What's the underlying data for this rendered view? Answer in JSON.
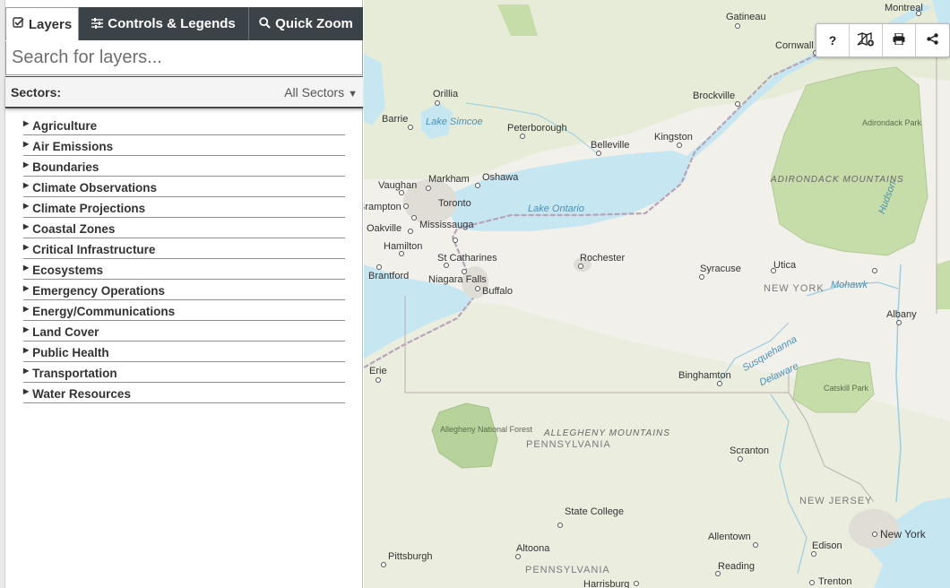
{
  "tabs": [
    {
      "label": "Layers",
      "icon": "checkbox-icon"
    },
    {
      "label": "Controls & Legends",
      "icon": "sliders-icon"
    },
    {
      "label": "Quick Zoom",
      "icon": "search-icon"
    }
  ],
  "search": {
    "placeholder": "Search for layers..."
  },
  "sectors": {
    "label": "Sectors:",
    "selected": "All Sectors"
  },
  "layers": [
    "Agriculture",
    "Air Emissions",
    "Boundaries",
    "Climate Observations",
    "Climate Projections",
    "Coastal Zones",
    "Critical Infrastructure",
    "Ecosystems",
    "Emergency Operations",
    "Energy/Communications",
    "Land Cover",
    "Public Health",
    "Transportation",
    "Water Resources"
  ],
  "toolbar": {
    "help": "?",
    "icons": [
      "help-icon",
      "add-map-icon",
      "print-icon",
      "share-icon"
    ]
  },
  "map": {
    "cities": [
      "Gatineau",
      "Montreal",
      "Cornwall",
      "Orillia",
      "Barrie",
      "Peterborough",
      "Brockville",
      "Belleville",
      "Kingston",
      "Markham",
      "Oshawa",
      "Vaughan",
      "Toronto",
      "Brampton",
      "Mississauga",
      "Oakville",
      "Hamilton",
      "St Catharines",
      "Brantford",
      "Niagara Falls",
      "Buffalo",
      "Rochester",
      "Syracuse",
      "Utica",
      "Albany",
      "Erie",
      "Binghamton",
      "Scranton",
      "State College",
      "Altoona",
      "Pittsburgh",
      "Allentown",
      "Edison",
      "New York",
      "Reading",
      "Harrisburg",
      "Trenton"
    ],
    "water": [
      "Lake Simcoe",
      "Lake Ontario",
      "Mohawk",
      "Hudson",
      "Susquehanna",
      "Delaware"
    ],
    "regions": [
      "NEW YORK",
      "PENNSYLVANIA",
      "NEW JERSEY",
      "PENNSYLVANIA"
    ],
    "mountains": [
      "ADIRONDACK MOUNTAINS",
      "ALLEGHENY MOUNTAINS"
    ],
    "parks": [
      "Adirondack Park",
      "Catskill Park",
      "Allegheny National Forest"
    ]
  },
  "colors": {
    "tab_bg": "#3c4348",
    "water": "#c6e6f2",
    "land": "#f1f0ea",
    "forest": "#d9e8c8",
    "park": "#b5d196"
  }
}
